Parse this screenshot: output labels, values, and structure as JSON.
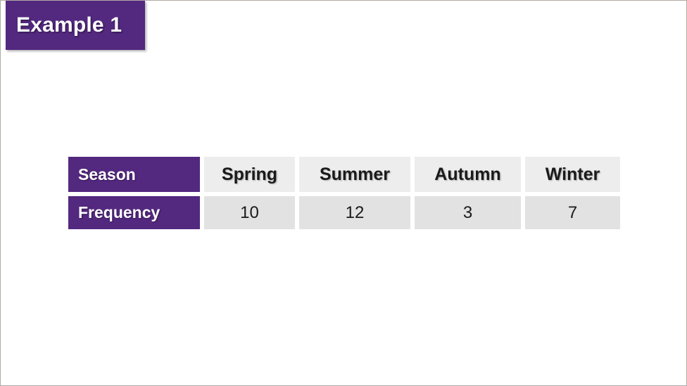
{
  "slide": {
    "background_color": "#ffffff",
    "border_color": "#b3aaa4",
    "accent_color": "#53287f",
    "header_cell_color": "#ededed",
    "data_cell_color": "#e2e2e2",
    "text_color": "#1a1a1a"
  },
  "badge": {
    "label": "Example 1"
  },
  "table": {
    "row_labels": {
      "season": "Season",
      "frequency": "Frequency"
    },
    "columns": [
      "Spring",
      "Summer",
      "Autumn",
      "Winter"
    ],
    "frequencies": [
      "10",
      "12",
      "3",
      "7"
    ]
  },
  "chart_data": {
    "type": "table",
    "title": "Example 1",
    "categories": [
      "Spring",
      "Summer",
      "Autumn",
      "Winter"
    ],
    "values": [
      10,
      12,
      3,
      7
    ],
    "xlabel": "Season",
    "ylabel": "Frequency",
    "row_headers": [
      "Season",
      "Frequency"
    ],
    "orientation": "horizontal",
    "grid": false,
    "legend": "none"
  }
}
